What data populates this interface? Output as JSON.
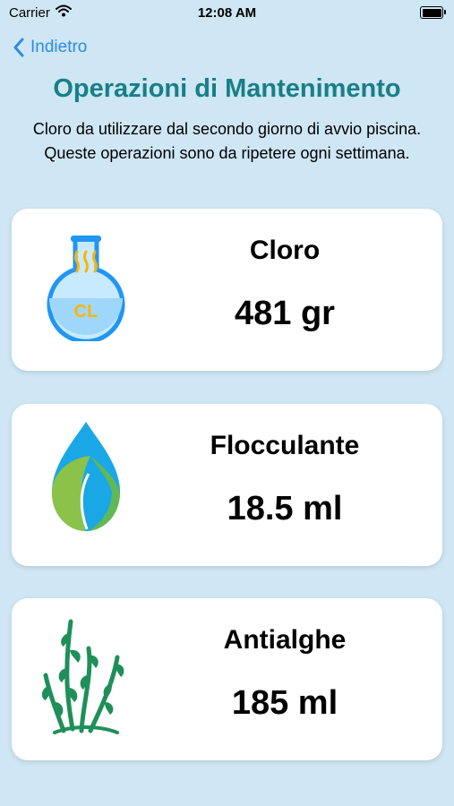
{
  "status_bar": {
    "carrier": "Carrier",
    "time": "12:08 AM"
  },
  "nav": {
    "back_label": "Indietro"
  },
  "header": {
    "title": "Operazioni di Mantenimento",
    "subtitle": "Cloro da utilizzare dal secondo giorno di avvio piscina. Queste operazioni sono da ripetere ogni settimana."
  },
  "cards": [
    {
      "name": "Cloro",
      "value": "481 gr",
      "icon": "chlorine-flask-icon",
      "icon_text": "CL"
    },
    {
      "name": "Flocculante",
      "value": "18.5 ml",
      "icon": "water-leaf-drop-icon"
    },
    {
      "name": "Antialghe",
      "value": "185 ml",
      "icon": "seaweed-icon"
    }
  ],
  "colors": {
    "background": "#cfe6f4",
    "title": "#177f87",
    "accent": "#2e8be0"
  }
}
